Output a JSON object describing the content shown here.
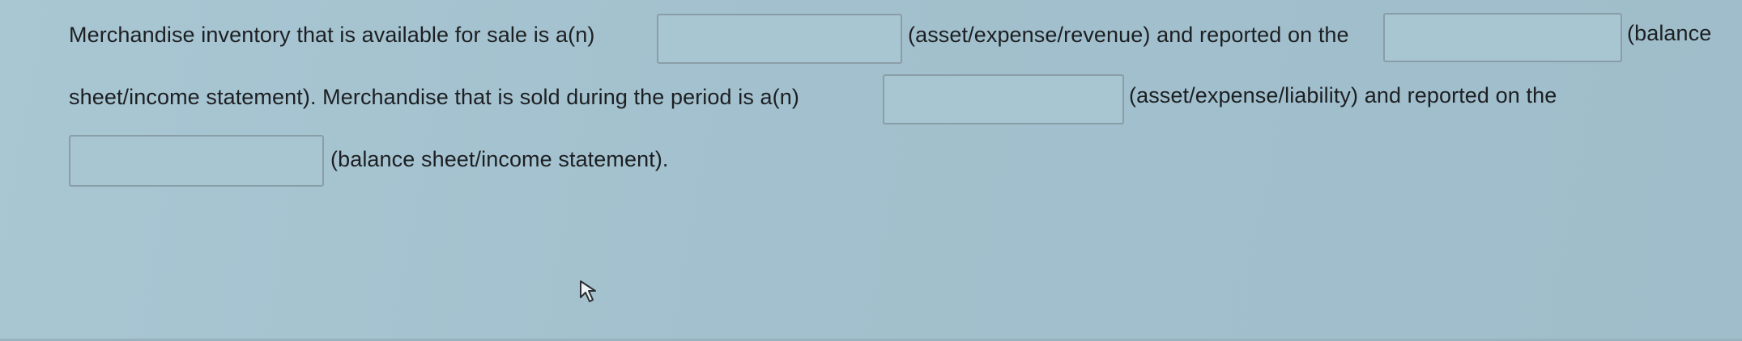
{
  "question": {
    "line1": {
      "text_before": "Merchandise inventory that is available for sale is a(n)",
      "text_middle": "(asset/expense/revenue) and reported on the",
      "text_after": "(balance"
    },
    "line2": {
      "text_before": "sheet/income statement). Merchandise that is sold during the period is a(n)",
      "text_after": "(asset/expense/liability) and reported on the"
    },
    "line3": {
      "text_after": "(balance sheet/income statement)."
    },
    "blanks": {
      "blank1_value": "",
      "blank2_value": "",
      "blank3_value": "",
      "blank4_value": ""
    }
  },
  "pointer": {
    "icon": "mouse-pointer-icon"
  }
}
